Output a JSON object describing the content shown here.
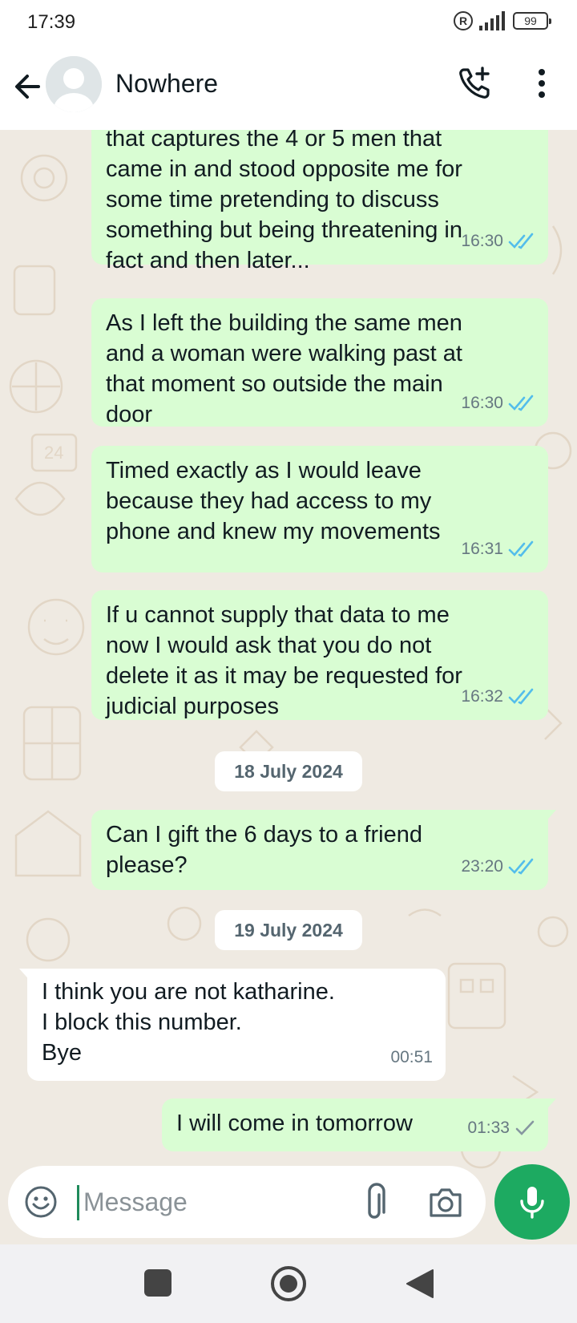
{
  "status_bar": {
    "time": "17:39",
    "r_badge": "R",
    "battery": "99"
  },
  "header": {
    "contact_name": "Nowhere"
  },
  "messages": [
    {
      "direction": "out",
      "text": "that captures the 4 or 5 men that\ncame in and stood opposite me for\nsome time pretending to discuss\nsomething but being threatening in\nfact and then later...",
      "time": "16:30",
      "status": "read"
    },
    {
      "direction": "out",
      "text": "As I left the building the same men\nand a woman were walking past at\nthat moment so outside the main\ndoor",
      "time": "16:30",
      "status": "read"
    },
    {
      "direction": "out",
      "text": "Timed exactly as I would leave\nbecause they had access to my\nphone and knew my movements",
      "time": "16:31",
      "status": "read"
    },
    {
      "direction": "out",
      "text": "If u cannot supply that data to me\nnow I would ask that you do not\ndelete it as it may be requested for\njudicial purposes",
      "time": "16:32",
      "status": "read"
    },
    {
      "direction": "out",
      "text": "Can I gift the 6 days to a friend\nplease?",
      "time": "23:20",
      "status": "read"
    },
    {
      "direction": "in",
      "text": "I think you are not katharine.\nI block this number.\nBye",
      "time": "00:51"
    },
    {
      "direction": "out",
      "text": "I will come in tomorrow",
      "time": "01:33",
      "status": "sent"
    }
  ],
  "date_separators": [
    "18 July 2024",
    "19 July 2024"
  ],
  "composer": {
    "placeholder": "Message"
  },
  "colors": {
    "outgoing_bubble": "#d9fdd3",
    "incoming_bubble": "#ffffff",
    "accent": "#1daa61",
    "read_tick": "#53bdeb",
    "chat_background": "#efeae2"
  }
}
